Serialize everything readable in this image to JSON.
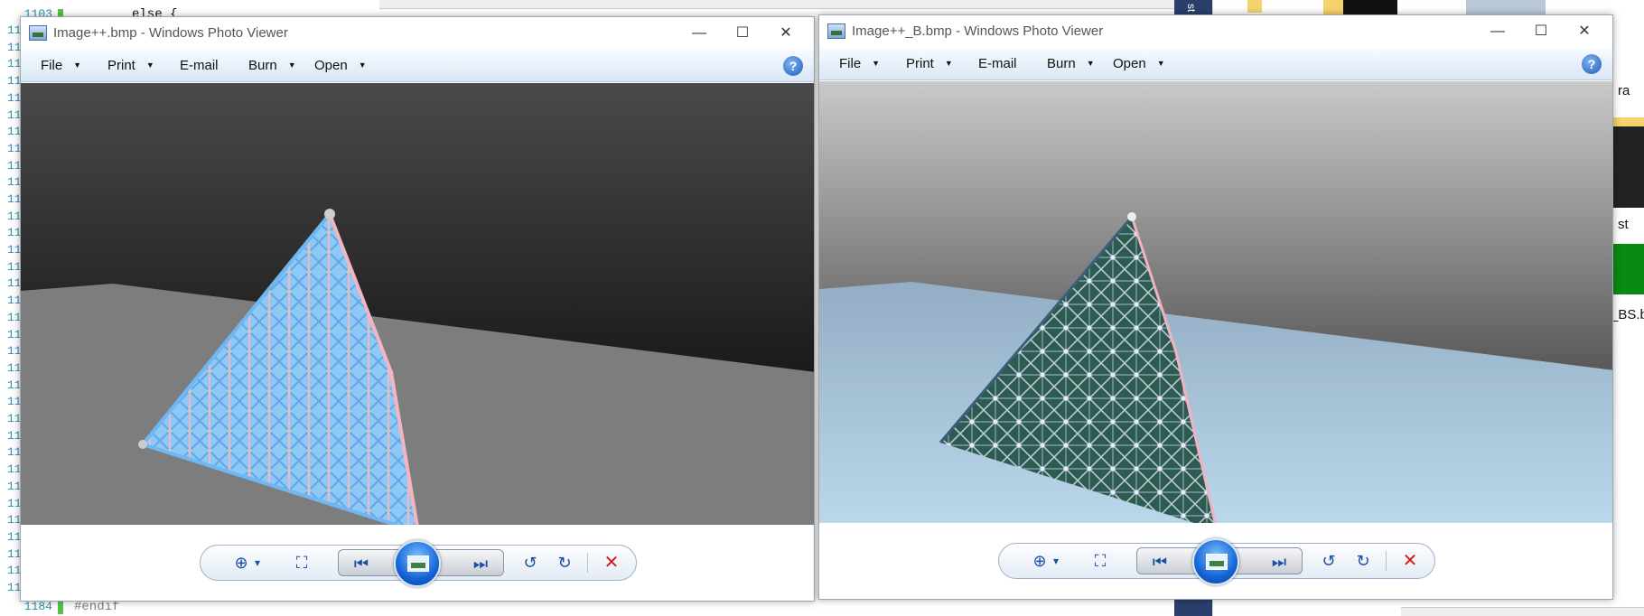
{
  "editor": {
    "top_line": "1103",
    "top_code": "else {",
    "bottom_line": "1184",
    "bottom_code": "#endif",
    "line_prefix": "11"
  },
  "side_strip": {
    "text": "st"
  },
  "explorer": {
    "labels": [
      "ra",
      "st",
      "_BS.b"
    ]
  },
  "window_a": {
    "title": "Image++.bmp - Windows Photo Viewer",
    "menu": [
      "File",
      "Print",
      "E-mail",
      "Burn",
      "Open"
    ],
    "dropdown_menus": [
      true,
      true,
      false,
      true,
      true
    ],
    "help": "?",
    "minimize": "—",
    "maximize": "☐",
    "close": "✕"
  },
  "window_b": {
    "title": "Image++_B.bmp - Windows Photo Viewer",
    "menu": [
      "File",
      "Print",
      "E-mail",
      "Burn",
      "Open"
    ],
    "dropdown_menus": [
      true,
      true,
      false,
      true,
      true
    ],
    "help": "?",
    "minimize": "—",
    "maximize": "☐",
    "close": "✕"
  },
  "controls": {
    "zoom": "⊕",
    "zoom_caret": "▾",
    "fit": "⛶",
    "previous": "⏮",
    "next": "⏭",
    "rotate_ccw": "↺",
    "rotate_cw": "↻",
    "delete": "✕"
  },
  "icons": {
    "window_icon": "photo-viewer-icon",
    "help": "help-icon",
    "slideshow": "slideshow-icon"
  },
  "colors": {
    "titlebar": "#ffffff",
    "menubar_top": "#f7fbff",
    "menubar_bottom": "#dae7f5",
    "accent_blue": "#1b4fa3",
    "delete_red": "#d01b1b"
  }
}
